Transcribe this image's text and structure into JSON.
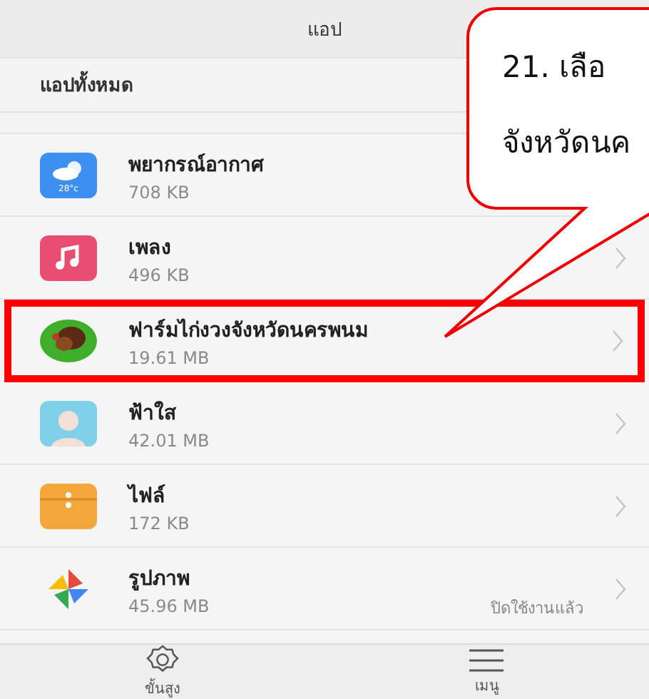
{
  "header": {
    "title": "แอป"
  },
  "section_title": "แอปทั้งหมด",
  "apps": [
    {
      "name": "พยากรณ์อากาศ",
      "size": "708 KB",
      "icon_text": "28°c",
      "highlighted": false
    },
    {
      "name": "เพลง",
      "size": "496 KB",
      "highlighted": false
    },
    {
      "name": "ฟาร์มไก่งวงจังหวัดนครพนม",
      "size": "19.61 MB",
      "highlighted": true
    },
    {
      "name": "ฟ้าใส",
      "size": "42.01 MB",
      "highlighted": false
    },
    {
      "name": "ไฟล์",
      "size": "172 KB",
      "highlighted": false
    },
    {
      "name": "รูปภาพ",
      "size": "45.96 MB",
      "status": "ปิดใช้งานแล้ว",
      "highlighted": false
    }
  ],
  "callout": {
    "lines": [
      "21.  เลือ",
      "จังหวัดนค"
    ]
  },
  "bottom_nav": [
    {
      "label": "ขั้นสูง"
    },
    {
      "label": "เมนู"
    }
  ]
}
